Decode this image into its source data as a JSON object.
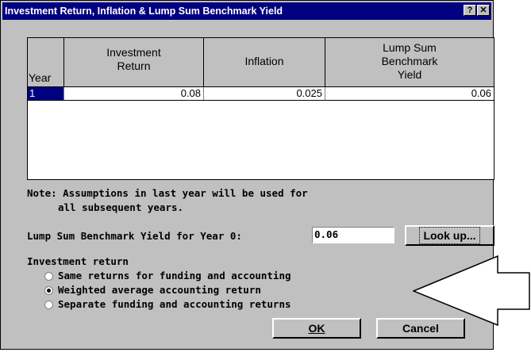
{
  "window": {
    "title": "Investment Return, Inflation & Lump Sum Benchmark Yield",
    "help_btn": "?",
    "close_btn": "✕"
  },
  "table": {
    "headers": [
      "Year",
      "Investment\nReturn",
      "Inflation",
      "Lump Sum\nBenchmark\nYield"
    ],
    "rows": [
      {
        "year": "1",
        "investment_return": "0.08",
        "inflation": "0.025",
        "lump_sum_yield": "0.06"
      }
    ]
  },
  "note": {
    "line1": "Note: Assumptions in last year will be used for",
    "line2": "all subsequent years."
  },
  "year0": {
    "label": "Lump Sum Benchmark Yield for Year 0:",
    "value": "0.06",
    "lookup_label": "Look up..."
  },
  "investment_return": {
    "group_label": "Investment return",
    "options": [
      {
        "label": "Same returns for funding and accounting",
        "selected": false
      },
      {
        "label": "Weighted average accounting return",
        "selected": true
      },
      {
        "label": "Separate funding and accounting returns",
        "selected": false
      }
    ]
  },
  "buttons": {
    "ok_label": "OK",
    "cancel_label": "Cancel"
  }
}
